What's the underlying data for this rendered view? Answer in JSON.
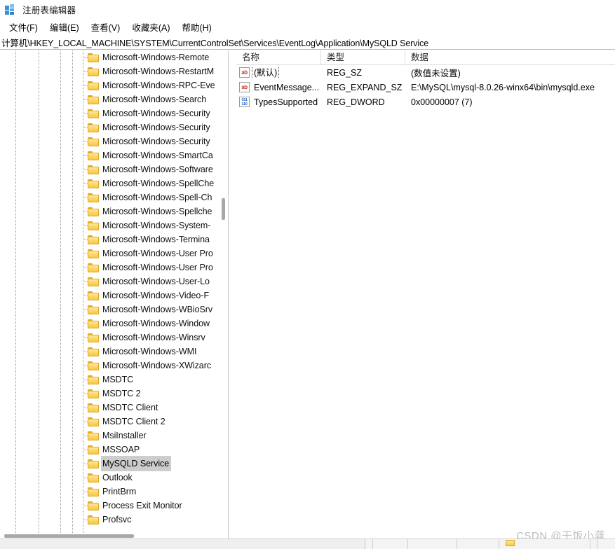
{
  "window": {
    "title": "注册表编辑器",
    "icon": "registry-editor-icon"
  },
  "menubar": {
    "items": [
      {
        "label": "文件(F)",
        "name": "menu-file"
      },
      {
        "label": "编辑(E)",
        "name": "menu-edit"
      },
      {
        "label": "查看(V)",
        "name": "menu-view"
      },
      {
        "label": "收藏夹(A)",
        "name": "menu-favorites"
      },
      {
        "label": "帮助(H)",
        "name": "menu-help"
      }
    ]
  },
  "address": {
    "path": "计算机\\HKEY_LOCAL_MACHINE\\SYSTEM\\CurrentControlSet\\Services\\EventLog\\Application\\MySQLD Service"
  },
  "tree": {
    "selected_key": "MySQLD Service",
    "items": [
      {
        "label": "Microsoft-Windows-Remote",
        "truncated": true
      },
      {
        "label": "Microsoft-Windows-RestartM",
        "truncated": true
      },
      {
        "label": "Microsoft-Windows-RPC-Eve",
        "truncated": true
      },
      {
        "label": "Microsoft-Windows-Search",
        "truncated": false
      },
      {
        "label": "Microsoft-Windows-Security",
        "truncated": true
      },
      {
        "label": "Microsoft-Windows-Security",
        "truncated": true
      },
      {
        "label": "Microsoft-Windows-Security",
        "truncated": true
      },
      {
        "label": "Microsoft-Windows-SmartCa",
        "truncated": true
      },
      {
        "label": "Microsoft-Windows-Software",
        "truncated": true
      },
      {
        "label": "Microsoft-Windows-SpellChe",
        "truncated": true
      },
      {
        "label": "Microsoft-Windows-Spell-Ch",
        "truncated": true
      },
      {
        "label": "Microsoft-Windows-Spellche",
        "truncated": true
      },
      {
        "label": "Microsoft-Windows-System-",
        "truncated": true
      },
      {
        "label": "Microsoft-Windows-Termina",
        "truncated": true
      },
      {
        "label": "Microsoft-Windows-User Pro",
        "truncated": true
      },
      {
        "label": "Microsoft-Windows-User Pro",
        "truncated": true
      },
      {
        "label": "Microsoft-Windows-User-Lo",
        "truncated": true
      },
      {
        "label": "Microsoft-Windows-Video-F",
        "truncated": true
      },
      {
        "label": "Microsoft-Windows-WBioSrv",
        "truncated": true
      },
      {
        "label": "Microsoft-Windows-Window",
        "truncated": true
      },
      {
        "label": "Microsoft-Windows-Winsrv",
        "truncated": false
      },
      {
        "label": "Microsoft-Windows-WMI",
        "truncated": false
      },
      {
        "label": "Microsoft-Windows-XWizarc",
        "truncated": true
      },
      {
        "label": "MSDTC",
        "truncated": false
      },
      {
        "label": "MSDTC 2",
        "truncated": false
      },
      {
        "label": "MSDTC Client",
        "truncated": false
      },
      {
        "label": "MSDTC Client 2",
        "truncated": false
      },
      {
        "label": "MsiInstaller",
        "truncated": false
      },
      {
        "label": "MSSOAP",
        "truncated": false
      },
      {
        "label": "MySQLD Service",
        "truncated": false,
        "selected": true
      },
      {
        "label": "Outlook",
        "truncated": false
      },
      {
        "label": "PrintBrm",
        "truncated": false
      },
      {
        "label": "Process Exit Monitor",
        "truncated": false
      },
      {
        "label": "Profsvc",
        "truncated": false
      }
    ]
  },
  "values": {
    "columns": [
      "名称",
      "类型",
      "数据"
    ],
    "rows": [
      {
        "name": "(默认)",
        "type": "REG_SZ",
        "data": "(数值未设置)",
        "icon": "string-value-icon",
        "focused": true
      },
      {
        "name": "EventMessage...",
        "type": "REG_EXPAND_SZ",
        "data": "E:\\MySQL\\mysql-8.0.26-winx64\\bin\\mysqld.exe",
        "icon": "string-value-icon",
        "focused": false
      },
      {
        "name": "TypesSupported",
        "type": "REG_DWORD",
        "data": "0x00000007 (7)",
        "icon": "dword-value-icon",
        "focused": false
      }
    ]
  },
  "watermark": {
    "text": "CSDN @干饭小龚"
  },
  "icon_glyphs": {
    "string": "ab",
    "dword_top": "011",
    "dword_bottom": "110"
  },
  "colors": {
    "folder": "#f7c842",
    "string_icon": "#c0392b",
    "dword_icon": "#2761b3",
    "selection": "#cdcdcd",
    "watermark": "#bdbdbd"
  }
}
